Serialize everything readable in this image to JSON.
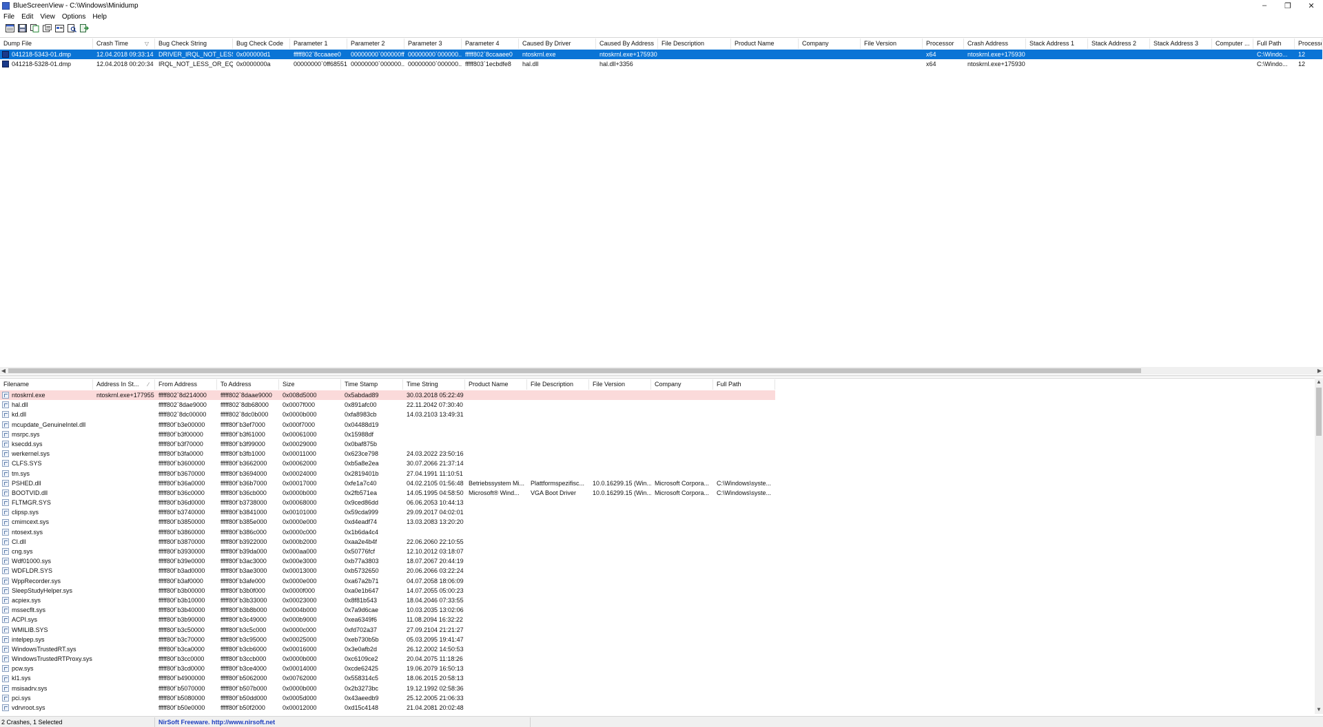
{
  "window": {
    "title": "BlueScreenView  -  C:\\Windows\\Minidump",
    "minimize_glyph": "–",
    "restore_glyph": "❐",
    "close_glyph": "✕"
  },
  "menu": [
    "File",
    "Edit",
    "View",
    "Options",
    "Help"
  ],
  "toolbar_icons": [
    "html-report-icon",
    "save-icon",
    "copy-icon",
    "properties-icon",
    "options-icon",
    "find-icon",
    "exit-icon"
  ],
  "upper": {
    "columns": [
      "Dump File",
      "Crash Time",
      "Bug Check String",
      "Bug Check Code",
      "Parameter 1",
      "Parameter 2",
      "Parameter 3",
      "Parameter 4",
      "Caused By Driver",
      "Caused By Address",
      "File Description",
      "Product Name",
      "Company",
      "File Version",
      "Processor",
      "Crash Address",
      "Stack Address 1",
      "Stack Address 2",
      "Stack Address 3",
      "Computer ...",
      "Full Path",
      "Processor ..."
    ],
    "sort_arrow": "▽",
    "rows": [
      [
        "041218-5343-01.dmp",
        "12.04.2018 09:33:14",
        "DRIVER_IRQL_NOT_LESS...",
        "0x000000d1",
        "fffff802`8ccaaee0",
        "00000000`000000ff",
        "00000000`000000...",
        "fffff802`8ccaaee0",
        "ntoskrnl.exe",
        "ntoskrnl.exe+175930",
        "",
        "",
        "",
        "",
        "x64",
        "ntoskrnl.exe+175930",
        "",
        "",
        "",
        "",
        "C:\\Windo...",
        "12"
      ],
      [
        "041218-5328-01.dmp",
        "12.04.2018 00:20:34",
        "IRQL_NOT_LESS_OR_EQ...",
        "0x0000000a",
        "00000000`0ff68551",
        "00000000`000000...",
        "00000000`000000...",
        "fffff803`1ecbdfe8",
        "hal.dll",
        "hal.dll+3356",
        "",
        "",
        "",
        "",
        "x64",
        "ntoskrnl.exe+175930",
        "",
        "",
        "",
        "",
        "C:\\Windo...",
        "12"
      ]
    ]
  },
  "lower": {
    "columns": [
      "Filename",
      "Address In St...",
      "From Address",
      "To Address",
      "Size",
      "Time Stamp",
      "Time String",
      "Product Name",
      "File Description",
      "File Version",
      "Company",
      "Full Path"
    ],
    "sort_arrow": "∕",
    "rows": [
      [
        "ntoskrnl.exe",
        "ntoskrnl.exe+177955",
        "fffff802`8d214000",
        "fffff802`8daae9000",
        "0x008d5000",
        "0x5abdad89",
        "30.03.2018 05:22:49",
        "",
        "",
        "",
        "",
        ""
      ],
      [
        "hal.dll",
        "",
        "fffff802`8dae9000",
        "fffff802`8db68000",
        "0x0007f000",
        "0x891afc00",
        "22.11.2042 07:30:40",
        "",
        "",
        "",
        "",
        ""
      ],
      [
        "kd.dll",
        "",
        "fffff802`8dc00000",
        "fffff802`8dc0b000",
        "0x0000b000",
        "0xfa8983cb",
        "14.03.2103 13:49:31",
        "",
        "",
        "",
        "",
        ""
      ],
      [
        "mcupdate_GenuineIntel.dll",
        "",
        "fffff80f`b3e00000",
        "fffff80f`b3ef7000",
        "0x000f7000",
        "0x04488d19",
        "",
        "",
        "",
        "",
        "",
        ""
      ],
      [
        "msrpc.sys",
        "",
        "fffff80f`b3f00000",
        "fffff80f`b3f61000",
        "0x00061000",
        "0x15988df",
        "",
        "",
        "",
        "",
        "",
        ""
      ],
      [
        "ksecdd.sys",
        "",
        "fffff80f`b3f70000",
        "fffff80f`b3f99000",
        "0x00029000",
        "0x0baf875b",
        "",
        "",
        "",
        "",
        "",
        ""
      ],
      [
        "werkernel.sys",
        "",
        "fffff80f`b3fa0000",
        "fffff80f`b3fb1000",
        "0x00011000",
        "0x623ce798",
        "24.03.2022 23:50:16",
        "",
        "",
        "",
        "",
        ""
      ],
      [
        "CLFS.SYS",
        "",
        "fffff80f`b3600000",
        "fffff80f`b3662000",
        "0x00062000",
        "0xb5a8e2ea",
        "30.07.2066 21:37:14",
        "",
        "",
        "",
        "",
        ""
      ],
      [
        "tm.sys",
        "",
        "fffff80f`b3670000",
        "fffff80f`b3694000",
        "0x00024000",
        "0x2819401b",
        "27.04.1991 11:10:51",
        "",
        "",
        "",
        "",
        ""
      ],
      [
        "PSHED.dll",
        "",
        "fffff80f`b36a0000",
        "fffff80f`b36b7000",
        "0x00017000",
        "0xfe1a7c40",
        "04.02.2105 01:56:48",
        "Betriebssystem Mi...",
        "Plattformspezifisc...",
        "10.0.16299.15 (Win...",
        "Microsoft Corpora...",
        "C:\\Windows\\syste..."
      ],
      [
        "BOOTVID.dll",
        "",
        "fffff80f`b36c0000",
        "fffff80f`b36cb000",
        "0x0000b000",
        "0x2fb571ea",
        "14.05.1995 04:58:50",
        "Microsoft® Wind...",
        "VGA Boot Driver",
        "10.0.16299.15 (Win...",
        "Microsoft Corpora...",
        "C:\\Windows\\syste..."
      ],
      [
        "FLTMGR.SYS",
        "",
        "fffff80f`b36d0000",
        "fffff80f`b3738000",
        "0x00068000",
        "0x9ced86dd",
        "06.06.2053 10:44:13",
        "",
        "",
        "",
        "",
        ""
      ],
      [
        "clipsp.sys",
        "",
        "fffff80f`b3740000",
        "fffff80f`b3841000",
        "0x00101000",
        "0x59cda999",
        "29.09.2017 04:02:01",
        "",
        "",
        "",
        "",
        ""
      ],
      [
        "cmimcext.sys",
        "",
        "fffff80f`b3850000",
        "fffff80f`b385e000",
        "0x0000e000",
        "0xd4eadf74",
        "13.03.2083 13:20:20",
        "",
        "",
        "",
        "",
        ""
      ],
      [
        "ntosext.sys",
        "",
        "fffff80f`b3860000",
        "fffff80f`b386c000",
        "0x0000c000",
        "0x1b6da4c4",
        "",
        "",
        "",
        "",
        "",
        ""
      ],
      [
        "CI.dll",
        "",
        "fffff80f`b3870000",
        "fffff80f`b3922000",
        "0x000b2000",
        "0xaa2e4b4f",
        "22.06.2060 22:10:55",
        "",
        "",
        "",
        "",
        ""
      ],
      [
        "cng.sys",
        "",
        "fffff80f`b3930000",
        "fffff80f`b39da000",
        "0x000aa000",
        "0x50776fcf",
        "12.10.2012 03:18:07",
        "",
        "",
        "",
        "",
        ""
      ],
      [
        "Wdf01000.sys",
        "",
        "fffff80f`b39e0000",
        "fffff80f`b3ac3000",
        "0x000e3000",
        "0xb77a3803",
        "18.07.2067 20:44:19",
        "",
        "",
        "",
        "",
        ""
      ],
      [
        "WDFLDR.SYS",
        "",
        "fffff80f`b3ad0000",
        "fffff80f`b3ae3000",
        "0x00013000",
        "0xb5732650",
        "20.06.2066 03:22:24",
        "",
        "",
        "",
        "",
        ""
      ],
      [
        "WppRecorder.sys",
        "",
        "fffff80f`b3af0000",
        "fffff80f`b3afe000",
        "0x0000e000",
        "0xa67a2b71",
        "04.07.2058 18:06:09",
        "",
        "",
        "",
        "",
        ""
      ],
      [
        "SleepStudyHelper.sys",
        "",
        "fffff80f`b3b00000",
        "fffff80f`b3b0f000",
        "0x0000f000",
        "0xa0e1b647",
        "14.07.2055 05:00:23",
        "",
        "",
        "",
        "",
        ""
      ],
      [
        "acpiex.sys",
        "",
        "fffff80f`b3b10000",
        "fffff80f`b3b33000",
        "0x00023000",
        "0x8f81b543",
        "18.04.2046 07:33:55",
        "",
        "",
        "",
        "",
        ""
      ],
      [
        "mssecflt.sys",
        "",
        "fffff80f`b3b40000",
        "fffff80f`b3b8b000",
        "0x0004b000",
        "0x7a9d6cae",
        "10.03.2035 13:02:06",
        "",
        "",
        "",
        "",
        ""
      ],
      [
        "ACPI.sys",
        "",
        "fffff80f`b3b90000",
        "fffff80f`b3c49000",
        "0x000b9000",
        "0xea6349f6",
        "11.08.2094 16:32:22",
        "",
        "",
        "",
        "",
        ""
      ],
      [
        "WMILIB.SYS",
        "",
        "fffff80f`b3c50000",
        "fffff80f`b3c5c000",
        "0x0000c000",
        "0xfd702a37",
        "27.09.2104 21:21:27",
        "",
        "",
        "",
        "",
        ""
      ],
      [
        "intelpep.sys",
        "",
        "fffff80f`b3c70000",
        "fffff80f`b3c95000",
        "0x00025000",
        "0xeb730b5b",
        "05.03.2095 19:41:47",
        "",
        "",
        "",
        "",
        ""
      ],
      [
        "WindowsTrustedRT.sys",
        "",
        "fffff80f`b3ca0000",
        "fffff80f`b3cb6000",
        "0x00016000",
        "0x3e0afb2d",
        "26.12.2002 14:50:53",
        "",
        "",
        "",
        "",
        ""
      ],
      [
        "WindowsTrustedRTProxy.sys",
        "",
        "fffff80f`b3cc0000",
        "fffff80f`b3ccb000",
        "0x0000b000",
        "0xc6109ce2",
        "20.04.2075 11:18:26",
        "",
        "",
        "",
        "",
        ""
      ],
      [
        "pcw.sys",
        "",
        "fffff80f`b3cd0000",
        "fffff80f`b3ce4000",
        "0x00014000",
        "0xcde62425",
        "19.06.2079 16:50:13",
        "",
        "",
        "",
        "",
        ""
      ],
      [
        "kl1.sys",
        "",
        "fffff80f`b4900000",
        "fffff80f`b5062000",
        "0x00762000",
        "0x558314c5",
        "18.06.2015 20:58:13",
        "",
        "",
        "",
        "",
        ""
      ],
      [
        "msisadrv.sys",
        "",
        "fffff80f`b5070000",
        "fffff80f`b507b000",
        "0x0000b000",
        "0x2b3273bc",
        "19.12.1992 02:58:36",
        "",
        "",
        "",
        "",
        ""
      ],
      [
        "pci.sys",
        "",
        "fffff80f`b5080000",
        "fffff80f`b50dd000",
        "0x0005d000",
        "0x43aeedb9",
        "25.12.2005 21:06:33",
        "",
        "",
        "",
        "",
        ""
      ],
      [
        "vdrvroot.sys",
        "",
        "fffff80f`b50e0000",
        "fffff80f`b50f2000",
        "0x00012000",
        "0xd15c4148",
        "21.04.2081 20:02:48",
        "",
        "",
        "",
        "",
        ""
      ]
    ]
  },
  "status": {
    "left": "2 Crashes, 1 Selected",
    "middle": "NirSoft Freeware.  http://www.nirsoft.net"
  },
  "colors": {
    "selection": "#0a74d6",
    "highlight_row": "#fbdada",
    "link": "#1f3fbf"
  }
}
